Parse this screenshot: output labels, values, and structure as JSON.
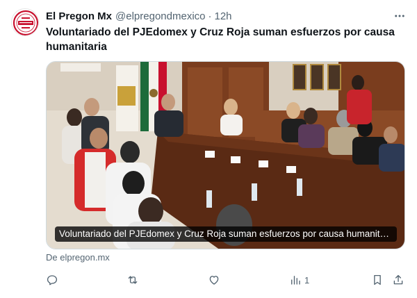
{
  "tweet": {
    "author_name": "El Pregon Mx",
    "handle": "@elpregondmexico",
    "separator": "·",
    "time": "12h",
    "text": "Voluntariado del PJEdomex y Cruz Roja suman esfuerzos por causa humanitaria",
    "card": {
      "title": "Voluntariado del PJEdomex y Cruz Roja suman esfuerzos por causa humanitari...",
      "source": "De elpregon.mx"
    },
    "stats": {
      "views": "1"
    }
  },
  "icons": {
    "avatar": "el-pregon-logo",
    "more": "more-dots-icon",
    "reply": "reply-icon",
    "retweet": "retweet-icon",
    "like": "heart-icon",
    "views": "views-chart-icon",
    "bookmark": "bookmark-icon",
    "share": "share-icon"
  },
  "colors": {
    "text": "#0f1419",
    "muted": "#536471",
    "border": "#cfd9de",
    "logo_red": "#c8102e"
  }
}
